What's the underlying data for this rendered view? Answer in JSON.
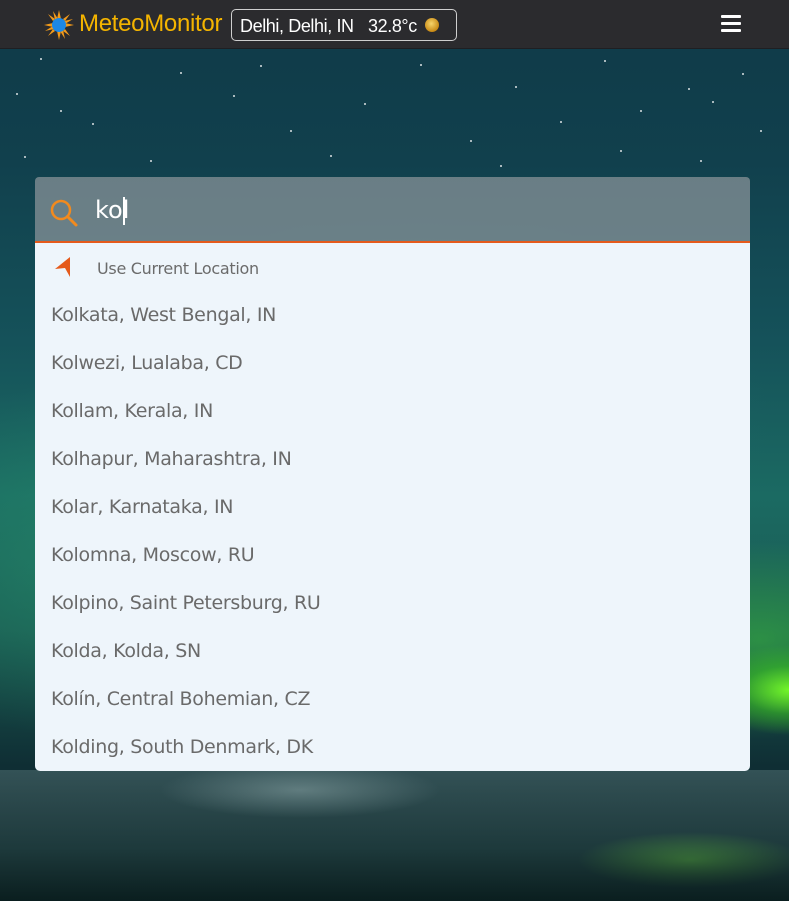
{
  "header": {
    "brand": "MeteoMonitor",
    "location": "Delhi, Delhi, IN",
    "temperature": "32.8°c",
    "weather_icon": "sun-haze-icon",
    "menu_icon": "hamburger-menu-icon"
  },
  "search": {
    "query": "kol",
    "icon": "search-icon",
    "current_location_label": "Use Current Location",
    "current_location_icon": "location-arrow-icon",
    "results": [
      "Kolkata, West Bengal, IN",
      "Kolwezi, Lualaba, CD",
      "Kollam, Kerala, IN",
      "Kolhapur, Maharashtra, IN",
      "Kolar, Karnataka, IN",
      "Kolomna, Moscow, RU",
      "Kolpino, Saint Petersburg, RU",
      "Kolda, Kolda, SN",
      "Kolín, Central Bohemian, CZ",
      "Kolding, South Denmark, DK"
    ]
  },
  "colors": {
    "brand": "#f4b400",
    "accent": "#e55a1b",
    "header_bg": "#2b2b2e",
    "dropdown_bg": "#eef5fb"
  }
}
